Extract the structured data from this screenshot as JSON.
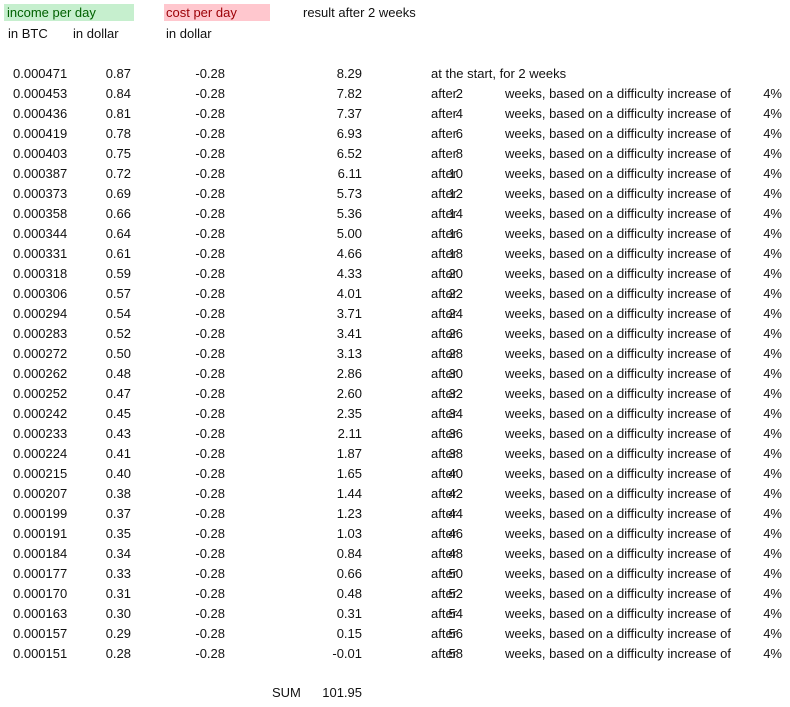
{
  "header": {
    "income_label": "income per day",
    "cost_label": "cost per day",
    "result_label": "result after 2 weeks",
    "sub_btc": "in BTC",
    "sub_income_dollar": "in dollar",
    "sub_cost_dollar": "in dollar"
  },
  "start_note": "at the start, for 2 weeks",
  "after_label": "after",
  "weeks_text": "weeks, based on a difficulty increase of",
  "percent": "4%",
  "rows": [
    {
      "btc": "0.000471",
      "usd": "0.87",
      "cost": "-0.28",
      "result": "8.29",
      "weeks": ""
    },
    {
      "btc": "0.000453",
      "usd": "0.84",
      "cost": "-0.28",
      "result": "7.82",
      "weeks": "2"
    },
    {
      "btc": "0.000436",
      "usd": "0.81",
      "cost": "-0.28",
      "result": "7.37",
      "weeks": "4"
    },
    {
      "btc": "0.000419",
      "usd": "0.78",
      "cost": "-0.28",
      "result": "6.93",
      "weeks": "6"
    },
    {
      "btc": "0.000403",
      "usd": "0.75",
      "cost": "-0.28",
      "result": "6.52",
      "weeks": "8"
    },
    {
      "btc": "0.000387",
      "usd": "0.72",
      "cost": "-0.28",
      "result": "6.11",
      "weeks": "10"
    },
    {
      "btc": "0.000373",
      "usd": "0.69",
      "cost": "-0.28",
      "result": "5.73",
      "weeks": "12"
    },
    {
      "btc": "0.000358",
      "usd": "0.66",
      "cost": "-0.28",
      "result": "5.36",
      "weeks": "14"
    },
    {
      "btc": "0.000344",
      "usd": "0.64",
      "cost": "-0.28",
      "result": "5.00",
      "weeks": "16"
    },
    {
      "btc": "0.000331",
      "usd": "0.61",
      "cost": "-0.28",
      "result": "4.66",
      "weeks": "18"
    },
    {
      "btc": "0.000318",
      "usd": "0.59",
      "cost": "-0.28",
      "result": "4.33",
      "weeks": "20"
    },
    {
      "btc": "0.000306",
      "usd": "0.57",
      "cost": "-0.28",
      "result": "4.01",
      "weeks": "22"
    },
    {
      "btc": "0.000294",
      "usd": "0.54",
      "cost": "-0.28",
      "result": "3.71",
      "weeks": "24"
    },
    {
      "btc": "0.000283",
      "usd": "0.52",
      "cost": "-0.28",
      "result": "3.41",
      "weeks": "26"
    },
    {
      "btc": "0.000272",
      "usd": "0.50",
      "cost": "-0.28",
      "result": "3.13",
      "weeks": "28"
    },
    {
      "btc": "0.000262",
      "usd": "0.48",
      "cost": "-0.28",
      "result": "2.86",
      "weeks": "30"
    },
    {
      "btc": "0.000252",
      "usd": "0.47",
      "cost": "-0.28",
      "result": "2.60",
      "weeks": "32"
    },
    {
      "btc": "0.000242",
      "usd": "0.45",
      "cost": "-0.28",
      "result": "2.35",
      "weeks": "34"
    },
    {
      "btc": "0.000233",
      "usd": "0.43",
      "cost": "-0.28",
      "result": "2.11",
      "weeks": "36"
    },
    {
      "btc": "0.000224",
      "usd": "0.41",
      "cost": "-0.28",
      "result": "1.87",
      "weeks": "38"
    },
    {
      "btc": "0.000215",
      "usd": "0.40",
      "cost": "-0.28",
      "result": "1.65",
      "weeks": "40"
    },
    {
      "btc": "0.000207",
      "usd": "0.38",
      "cost": "-0.28",
      "result": "1.44",
      "weeks": "42"
    },
    {
      "btc": "0.000199",
      "usd": "0.37",
      "cost": "-0.28",
      "result": "1.23",
      "weeks": "44"
    },
    {
      "btc": "0.000191",
      "usd": "0.35",
      "cost": "-0.28",
      "result": "1.03",
      "weeks": "46"
    },
    {
      "btc": "0.000184",
      "usd": "0.34",
      "cost": "-0.28",
      "result": "0.84",
      "weeks": "48"
    },
    {
      "btc": "0.000177",
      "usd": "0.33",
      "cost": "-0.28",
      "result": "0.66",
      "weeks": "50"
    },
    {
      "btc": "0.000170",
      "usd": "0.31",
      "cost": "-0.28",
      "result": "0.48",
      "weeks": "52"
    },
    {
      "btc": "0.000163",
      "usd": "0.30",
      "cost": "-0.28",
      "result": "0.31",
      "weeks": "54"
    },
    {
      "btc": "0.000157",
      "usd": "0.29",
      "cost": "-0.28",
      "result": "0.15",
      "weeks": "56"
    },
    {
      "btc": "0.000151",
      "usd": "0.28",
      "cost": "-0.28",
      "result": "-0.01",
      "weeks": "58"
    }
  ],
  "sum": {
    "label": "SUM",
    "value": "101.95"
  }
}
